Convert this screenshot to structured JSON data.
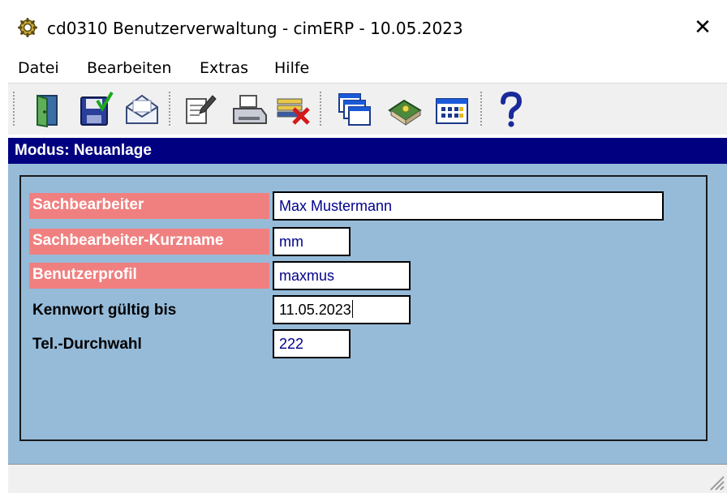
{
  "window": {
    "title": "cd0310 Benutzerverwaltung - cimERP - 10.05.2023",
    "close_label": "✕"
  },
  "menu": {
    "items": [
      {
        "label": "Datei"
      },
      {
        "label": "Bearbeiten"
      },
      {
        "label": "Extras"
      },
      {
        "label": "Hilfe"
      }
    ]
  },
  "toolbar": {
    "buttons": [
      {
        "icon": "exit-door-icon"
      },
      {
        "icon": "save-icon"
      },
      {
        "icon": "mail-icon"
      },
      {
        "icon": "edit-document-icon"
      },
      {
        "icon": "print-icon"
      },
      {
        "icon": "delete-icon"
      },
      {
        "icon": "windows-icon"
      },
      {
        "icon": "book-icon"
      },
      {
        "icon": "calendar-icon"
      },
      {
        "icon": "help-icon"
      }
    ]
  },
  "mode": {
    "text": "Modus: Neuanlage"
  },
  "form": {
    "sachbearbeiter": {
      "label": "Sachbearbeiter",
      "value": "Max Mustermann"
    },
    "kurzname": {
      "label": "Sachbearbeiter-Kurzname",
      "value": "mm"
    },
    "profil": {
      "label": "Benutzerprofil",
      "value": "maxmus"
    },
    "kennwort": {
      "label": "Kennwort gültig bis",
      "value": "11.05.2023"
    },
    "durchwahl": {
      "label": "Tel.-Durchwahl",
      "value": "222"
    }
  },
  "colors": {
    "mode_bar": "#000080",
    "content_bg": "#96bbd9",
    "required_label_bg": "#f08080",
    "field_text": "#00008b"
  }
}
